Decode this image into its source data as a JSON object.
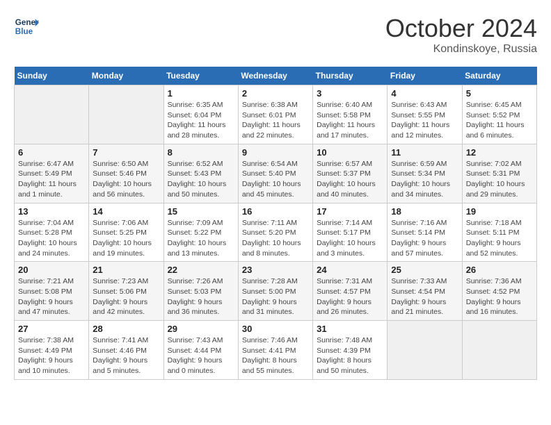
{
  "header": {
    "logo_line1": "General",
    "logo_line2": "Blue",
    "month": "October 2024",
    "location": "Kondinskoye, Russia"
  },
  "weekdays": [
    "Sunday",
    "Monday",
    "Tuesday",
    "Wednesday",
    "Thursday",
    "Friday",
    "Saturday"
  ],
  "weeks": [
    [
      {
        "day": "",
        "info": ""
      },
      {
        "day": "",
        "info": ""
      },
      {
        "day": "1",
        "info": "Sunrise: 6:35 AM\nSunset: 6:04 PM\nDaylight: 11 hours and 28 minutes."
      },
      {
        "day": "2",
        "info": "Sunrise: 6:38 AM\nSunset: 6:01 PM\nDaylight: 11 hours and 22 minutes."
      },
      {
        "day": "3",
        "info": "Sunrise: 6:40 AM\nSunset: 5:58 PM\nDaylight: 11 hours and 17 minutes."
      },
      {
        "day": "4",
        "info": "Sunrise: 6:43 AM\nSunset: 5:55 PM\nDaylight: 11 hours and 12 minutes."
      },
      {
        "day": "5",
        "info": "Sunrise: 6:45 AM\nSunset: 5:52 PM\nDaylight: 11 hours and 6 minutes."
      }
    ],
    [
      {
        "day": "6",
        "info": "Sunrise: 6:47 AM\nSunset: 5:49 PM\nDaylight: 11 hours and 1 minute."
      },
      {
        "day": "7",
        "info": "Sunrise: 6:50 AM\nSunset: 5:46 PM\nDaylight: 10 hours and 56 minutes."
      },
      {
        "day": "8",
        "info": "Sunrise: 6:52 AM\nSunset: 5:43 PM\nDaylight: 10 hours and 50 minutes."
      },
      {
        "day": "9",
        "info": "Sunrise: 6:54 AM\nSunset: 5:40 PM\nDaylight: 10 hours and 45 minutes."
      },
      {
        "day": "10",
        "info": "Sunrise: 6:57 AM\nSunset: 5:37 PM\nDaylight: 10 hours and 40 minutes."
      },
      {
        "day": "11",
        "info": "Sunrise: 6:59 AM\nSunset: 5:34 PM\nDaylight: 10 hours and 34 minutes."
      },
      {
        "day": "12",
        "info": "Sunrise: 7:02 AM\nSunset: 5:31 PM\nDaylight: 10 hours and 29 minutes."
      }
    ],
    [
      {
        "day": "13",
        "info": "Sunrise: 7:04 AM\nSunset: 5:28 PM\nDaylight: 10 hours and 24 minutes."
      },
      {
        "day": "14",
        "info": "Sunrise: 7:06 AM\nSunset: 5:25 PM\nDaylight: 10 hours and 19 minutes."
      },
      {
        "day": "15",
        "info": "Sunrise: 7:09 AM\nSunset: 5:22 PM\nDaylight: 10 hours and 13 minutes."
      },
      {
        "day": "16",
        "info": "Sunrise: 7:11 AM\nSunset: 5:20 PM\nDaylight: 10 hours and 8 minutes."
      },
      {
        "day": "17",
        "info": "Sunrise: 7:14 AM\nSunset: 5:17 PM\nDaylight: 10 hours and 3 minutes."
      },
      {
        "day": "18",
        "info": "Sunrise: 7:16 AM\nSunset: 5:14 PM\nDaylight: 9 hours and 57 minutes."
      },
      {
        "day": "19",
        "info": "Sunrise: 7:18 AM\nSunset: 5:11 PM\nDaylight: 9 hours and 52 minutes."
      }
    ],
    [
      {
        "day": "20",
        "info": "Sunrise: 7:21 AM\nSunset: 5:08 PM\nDaylight: 9 hours and 47 minutes."
      },
      {
        "day": "21",
        "info": "Sunrise: 7:23 AM\nSunset: 5:06 PM\nDaylight: 9 hours and 42 minutes."
      },
      {
        "day": "22",
        "info": "Sunrise: 7:26 AM\nSunset: 5:03 PM\nDaylight: 9 hours and 36 minutes."
      },
      {
        "day": "23",
        "info": "Sunrise: 7:28 AM\nSunset: 5:00 PM\nDaylight: 9 hours and 31 minutes."
      },
      {
        "day": "24",
        "info": "Sunrise: 7:31 AM\nSunset: 4:57 PM\nDaylight: 9 hours and 26 minutes."
      },
      {
        "day": "25",
        "info": "Sunrise: 7:33 AM\nSunset: 4:54 PM\nDaylight: 9 hours and 21 minutes."
      },
      {
        "day": "26",
        "info": "Sunrise: 7:36 AM\nSunset: 4:52 PM\nDaylight: 9 hours and 16 minutes."
      }
    ],
    [
      {
        "day": "27",
        "info": "Sunrise: 7:38 AM\nSunset: 4:49 PM\nDaylight: 9 hours and 10 minutes."
      },
      {
        "day": "28",
        "info": "Sunrise: 7:41 AM\nSunset: 4:46 PM\nDaylight: 9 hours and 5 minutes."
      },
      {
        "day": "29",
        "info": "Sunrise: 7:43 AM\nSunset: 4:44 PM\nDaylight: 9 hours and 0 minutes."
      },
      {
        "day": "30",
        "info": "Sunrise: 7:46 AM\nSunset: 4:41 PM\nDaylight: 8 hours and 55 minutes."
      },
      {
        "day": "31",
        "info": "Sunrise: 7:48 AM\nSunset: 4:39 PM\nDaylight: 8 hours and 50 minutes."
      },
      {
        "day": "",
        "info": ""
      },
      {
        "day": "",
        "info": ""
      }
    ]
  ]
}
